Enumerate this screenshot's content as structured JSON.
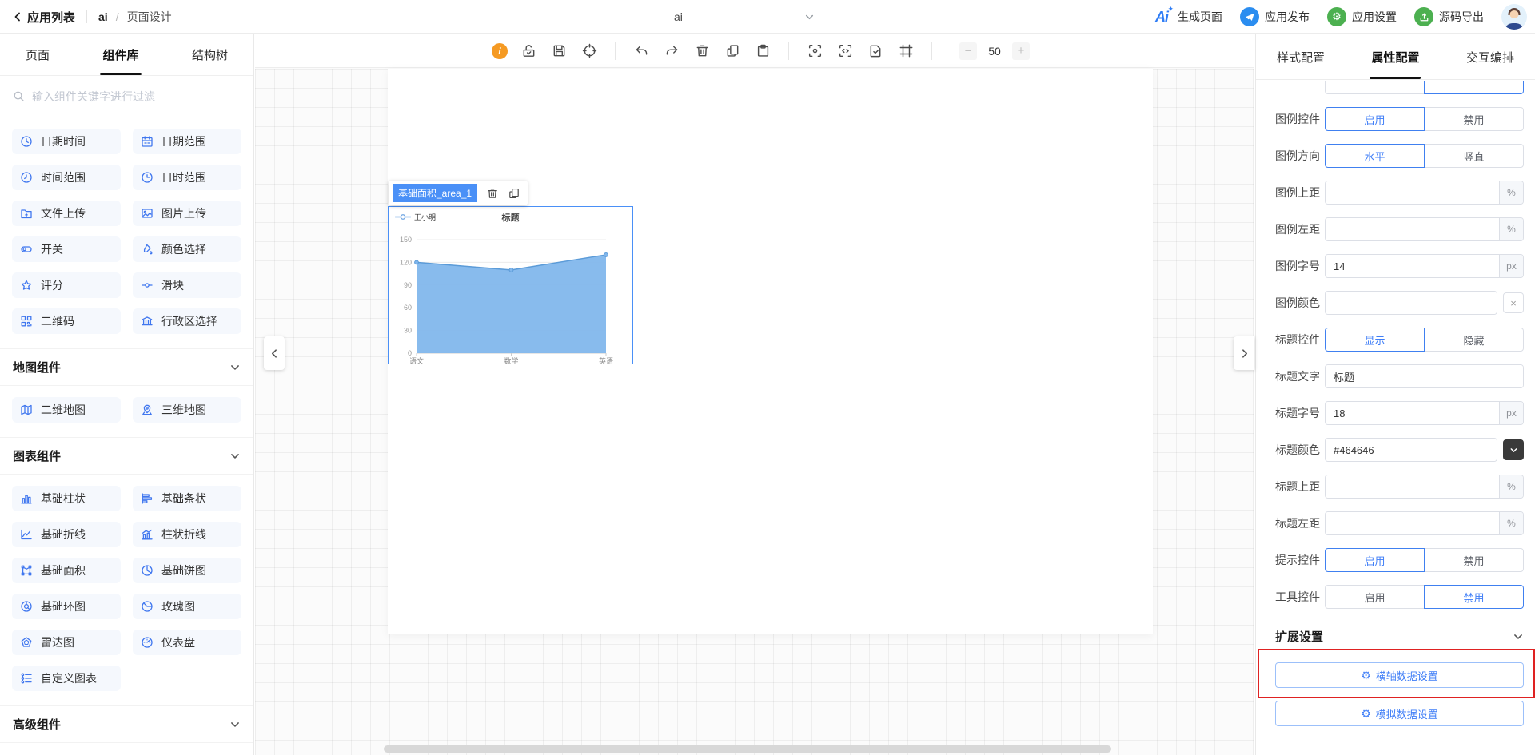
{
  "topbar": {
    "back_label": "应用列表",
    "app_name": "ai",
    "page_name": "页面设计",
    "center_selector_value": "ai",
    "actions": [
      {
        "key": "generate-page",
        "label": "生成页面",
        "icon": "ai-logo"
      },
      {
        "key": "publish-app",
        "label": "应用发布",
        "icon": "paper-plane",
        "circle_color": "#2b8df0"
      },
      {
        "key": "app-settings",
        "label": "应用设置",
        "icon": "gear",
        "circle_color": "#4cb050"
      },
      {
        "key": "export-source",
        "label": "源码导出",
        "icon": "export",
        "circle_color": "#4cb050"
      }
    ]
  },
  "sidebar": {
    "tabs": [
      {
        "key": "pages",
        "label": "页面",
        "active": false
      },
      {
        "key": "components",
        "label": "组件库",
        "active": true
      },
      {
        "key": "structure-tree",
        "label": "结构树",
        "active": false
      }
    ],
    "search_placeholder": "输入组件关键字进行过滤",
    "basic_items": [
      {
        "icon": "clock",
        "label": "日期时间"
      },
      {
        "icon": "calendar-range",
        "label": "日期范围"
      },
      {
        "icon": "time-range",
        "label": "时间范围"
      },
      {
        "icon": "day-time",
        "label": "日时范围"
      },
      {
        "icon": "folder-upload",
        "label": "文件上传"
      },
      {
        "icon": "image-upload",
        "label": "图片上传"
      },
      {
        "icon": "switch",
        "label": "开关"
      },
      {
        "icon": "color-select",
        "label": "颜色选择"
      },
      {
        "icon": "star",
        "label": "评分"
      },
      {
        "icon": "slider",
        "label": "滑块"
      },
      {
        "icon": "qrcode",
        "label": "二维码"
      },
      {
        "icon": "region-select",
        "label": "行政区选择"
      }
    ],
    "sections": [
      {
        "title": "地图组件",
        "items": [
          {
            "icon": "map-2d",
            "label": "二维地图"
          },
          {
            "icon": "map-3d",
            "label": "三维地图"
          }
        ]
      },
      {
        "title": "图表组件",
        "items": [
          {
            "icon": "bar-chart",
            "label": "基础柱状"
          },
          {
            "icon": "hbar-chart",
            "label": "基础条状"
          },
          {
            "icon": "line-chart",
            "label": "基础折线"
          },
          {
            "icon": "barline-chart",
            "label": "柱状折线"
          },
          {
            "icon": "area-chart",
            "label": "基础面积"
          },
          {
            "icon": "pie-chart",
            "label": "基础饼图"
          },
          {
            "icon": "donut-chart",
            "label": "基础环图"
          },
          {
            "icon": "rose-chart",
            "label": "玫瑰图"
          },
          {
            "icon": "radar-chart",
            "label": "雷达图"
          },
          {
            "icon": "gauge",
            "label": "仪表盘"
          },
          {
            "icon": "custom-chart",
            "label": "自定义图表"
          }
        ]
      },
      {
        "title": "高级组件",
        "items": []
      }
    ]
  },
  "toolbar": {
    "groups": [
      [
        "info",
        "unlock",
        "save",
        "target"
      ],
      [
        "undo",
        "redo",
        "trash",
        "copy",
        "paste"
      ],
      [
        "scan-preview",
        "scan-code",
        "doc-check",
        "frame"
      ]
    ],
    "zoom": {
      "out": "−",
      "value": "50",
      "in": "+"
    }
  },
  "canvas": {
    "selected_component_name": "基础面积_area_1"
  },
  "chart_data": {
    "type": "area",
    "title": "标题",
    "categories": [
      "语文",
      "数学",
      "英语"
    ],
    "series": [
      {
        "name": "王小明",
        "values": [
          120,
          110,
          130
        ]
      }
    ],
    "ylim": [
      0,
      150
    ],
    "yticks": [
      0,
      30,
      60,
      90,
      120,
      150
    ],
    "legend_position": "top-left",
    "grid": true,
    "colors": {
      "area": "#82b7ec",
      "line": "#5b9bd8",
      "axis": "#cccccc",
      "tick_label": "#999999"
    }
  },
  "panel": {
    "tabs": [
      {
        "key": "style-config",
        "label": "样式配置",
        "active": false
      },
      {
        "key": "property-config",
        "label": "属性配置",
        "active": true
      },
      {
        "key": "interaction-config",
        "label": "交互编排",
        "active": false
      }
    ],
    "clipped_row": {
      "options": [
        "",
        ""
      ],
      "selected": 1
    },
    "rows": [
      {
        "type": "toggle",
        "key": "legend-enable",
        "label": "图例控件",
        "options": [
          "启用",
          "禁用"
        ],
        "selected": 0
      },
      {
        "type": "toggle",
        "key": "legend-direction",
        "label": "图例方向",
        "options": [
          "水平",
          "竖直"
        ],
        "selected": 0
      },
      {
        "type": "input",
        "key": "legend-top",
        "label": "图例上距",
        "value": "",
        "suffix": "%"
      },
      {
        "type": "input",
        "key": "legend-left",
        "label": "图例左距",
        "value": "",
        "suffix": "%"
      },
      {
        "type": "input",
        "key": "legend-font-size",
        "label": "图例字号",
        "value": "14",
        "suffix": "px"
      },
      {
        "type": "color-clear",
        "key": "legend-color",
        "label": "图例颜色",
        "value": ""
      },
      {
        "type": "toggle",
        "key": "title-enable",
        "label": "标题控件",
        "options": [
          "显示",
          "隐藏"
        ],
        "selected": 0
      },
      {
        "type": "input",
        "key": "title-text",
        "label": "标题文字",
        "value": "标题",
        "suffix": null
      },
      {
        "type": "input",
        "key": "title-font-size",
        "label": "标题字号",
        "value": "18",
        "suffix": "px"
      },
      {
        "type": "color-dropdown",
        "key": "title-color",
        "label": "标题颜色",
        "value": "#464646"
      },
      {
        "type": "input",
        "key": "title-top",
        "label": "标题上距",
        "value": "",
        "suffix": "%"
      },
      {
        "type": "input",
        "key": "title-left",
        "label": "标题左距",
        "value": "",
        "suffix": "%"
      },
      {
        "type": "toggle",
        "key": "tooltip-enable",
        "label": "提示控件",
        "options": [
          "启用",
          "禁用"
        ],
        "selected": 0
      },
      {
        "type": "toggle",
        "key": "toolbox-enable",
        "label": "工具控件",
        "options": [
          "启用",
          "禁用"
        ],
        "selected": 1
      }
    ],
    "expand_section": {
      "title": "扩展设置",
      "buttons": [
        {
          "key": "xaxis-data-settings",
          "label": "横轴数据设置",
          "annotated": true
        },
        {
          "key": "mock-data-settings",
          "label": "模拟数据设置",
          "annotated": false
        }
      ],
      "annotation_color": "#df2222"
    }
  }
}
